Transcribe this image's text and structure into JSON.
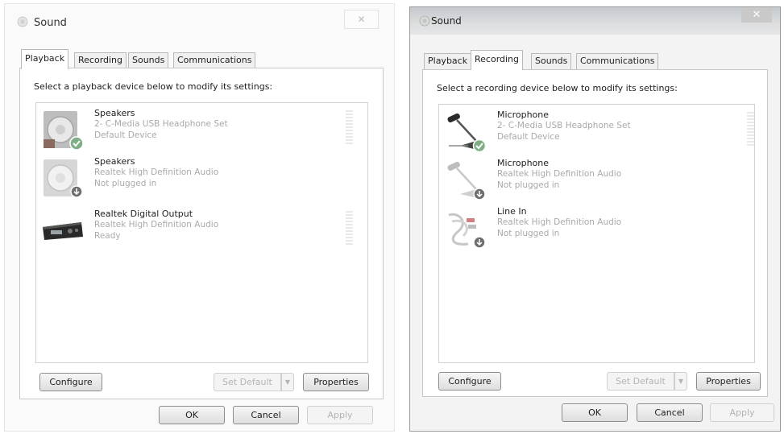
{
  "playback_dialog": {
    "title": "Sound",
    "close_glyph": "✕",
    "tabs": [
      "Playback",
      "Recording",
      "Sounds",
      "Communications"
    ],
    "active_tab": "Playback",
    "instruction": "Select a playback device below to modify its settings:",
    "devices": [
      {
        "name": "Speakers",
        "description": "2- C-Media USB Headphone Set",
        "status": "Default Device",
        "icon": "speaker-icon",
        "badge": "default-check-badge"
      },
      {
        "name": "Speakers",
        "description": "Realtek High Definition Audio",
        "status": "Not plugged in",
        "icon": "speaker-icon",
        "badge": "unplugged-arrow-badge"
      },
      {
        "name": "Realtek Digital Output",
        "description": "Realtek High Definition Audio",
        "status": "Ready",
        "icon": "digital-output-receiver-icon"
      }
    ],
    "buttons": {
      "configure": "Configure",
      "set_default": "Set Default",
      "set_default_arrow": "▼",
      "properties": "Properties",
      "ok": "OK",
      "cancel": "Cancel",
      "apply": "Apply"
    }
  },
  "recording_dialog": {
    "title": "Sound",
    "close_glyph": "✕",
    "tabs": [
      "Playback",
      "Recording",
      "Sounds",
      "Communications"
    ],
    "active_tab": "Recording",
    "instruction": "Select a recording device below to modify its settings:",
    "devices": [
      {
        "name": "Microphone",
        "description": "2- C-Media USB Headphone Set",
        "status": "Default Device",
        "icon": "microphone-icon",
        "badge": "default-check-badge"
      },
      {
        "name": "Microphone",
        "description": "Realtek High Definition Audio",
        "status": "Not plugged in",
        "icon": "microphone-icon",
        "badge": "unplugged-arrow-badge"
      },
      {
        "name": "Line In",
        "description": "Realtek High Definition Audio",
        "status": "Not plugged in",
        "icon": "line-in-cable-icon",
        "badge": "unplugged-arrow-badge"
      }
    ],
    "buttons": {
      "configure": "Configure",
      "set_default": "Set Default",
      "set_default_arrow": "▼",
      "properties": "Properties",
      "ok": "OK",
      "cancel": "Cancel",
      "apply": "Apply"
    }
  },
  "colors": {
    "disabled_text": "#b4b4b4",
    "device_detail_text": "#a9a9a9",
    "default_badge": "#7fae86"
  }
}
